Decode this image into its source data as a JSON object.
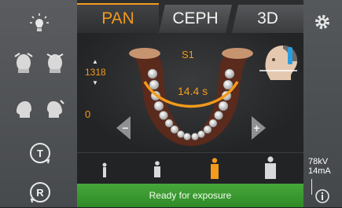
{
  "tabs": [
    {
      "label": "PAN",
      "active": true
    },
    {
      "label": "CEPH",
      "active": false
    },
    {
      "label": "3D",
      "active": false
    }
  ],
  "program_label": "S1",
  "height_value": "1318",
  "offset_value": "0",
  "exposure_time": "14.4 s",
  "left_panel": {
    "light_icon": "light-bulb-icon",
    "t_button": "T",
    "r_button": "R"
  },
  "status_text": "Ready for exposure",
  "kv": "78kV",
  "ma": "14mA",
  "accent": "#f29a1c",
  "status_color": "#3a9a30"
}
